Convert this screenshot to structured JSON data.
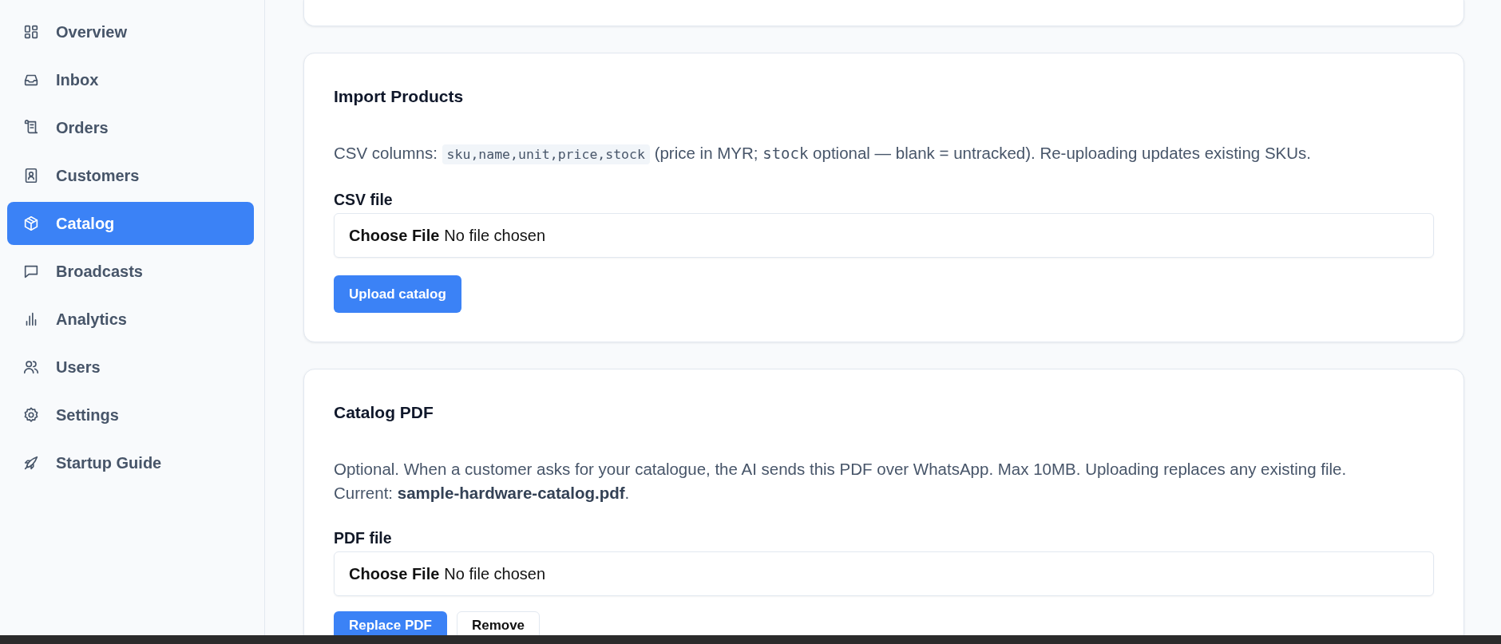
{
  "sidebar": {
    "items": [
      {
        "label": "Overview",
        "selected": false
      },
      {
        "label": "Inbox",
        "selected": false
      },
      {
        "label": "Orders",
        "selected": false
      },
      {
        "label": "Customers",
        "selected": false
      },
      {
        "label": "Catalog",
        "selected": true
      },
      {
        "label": "Broadcasts",
        "selected": false
      },
      {
        "label": "Analytics",
        "selected": false
      },
      {
        "label": "Users",
        "selected": false
      },
      {
        "label": "Settings",
        "selected": false
      },
      {
        "label": "Startup Guide",
        "selected": false
      }
    ]
  },
  "import_card": {
    "title": "Import Products",
    "description": [
      {
        "kind": "text",
        "text": "CSV columns: "
      },
      {
        "kind": "code",
        "text": "sku,name,unit,price,stock"
      },
      {
        "kind": "text",
        "text": " (price in MYR; "
      },
      {
        "kind": "mono",
        "text": "stock"
      },
      {
        "kind": "text",
        "text": " optional — blank = untracked). Re-uploading updates existing SKUs."
      }
    ],
    "field": {
      "label": "CSV file",
      "button": "Choose File",
      "status": "No file chosen"
    },
    "buttons": [
      {
        "label": "Upload catalog",
        "kind": "primary"
      }
    ]
  },
  "pdf_card": {
    "title": "Catalog PDF",
    "description_lines": [
      "Optional. When a customer asks for your catalogue, the AI sends this PDF over WhatsApp. Max 10MB. Uploading replaces any existing file.",
      "Current: **sample-hardware-catalog.pdf**."
    ],
    "field": {
      "label": "PDF file",
      "button": "Choose File",
      "status": "No file chosen"
    },
    "buttons": [
      {
        "label": "Replace PDF",
        "kind": "primary"
      },
      {
        "label": "Remove",
        "kind": "secondary"
      }
    ]
  }
}
